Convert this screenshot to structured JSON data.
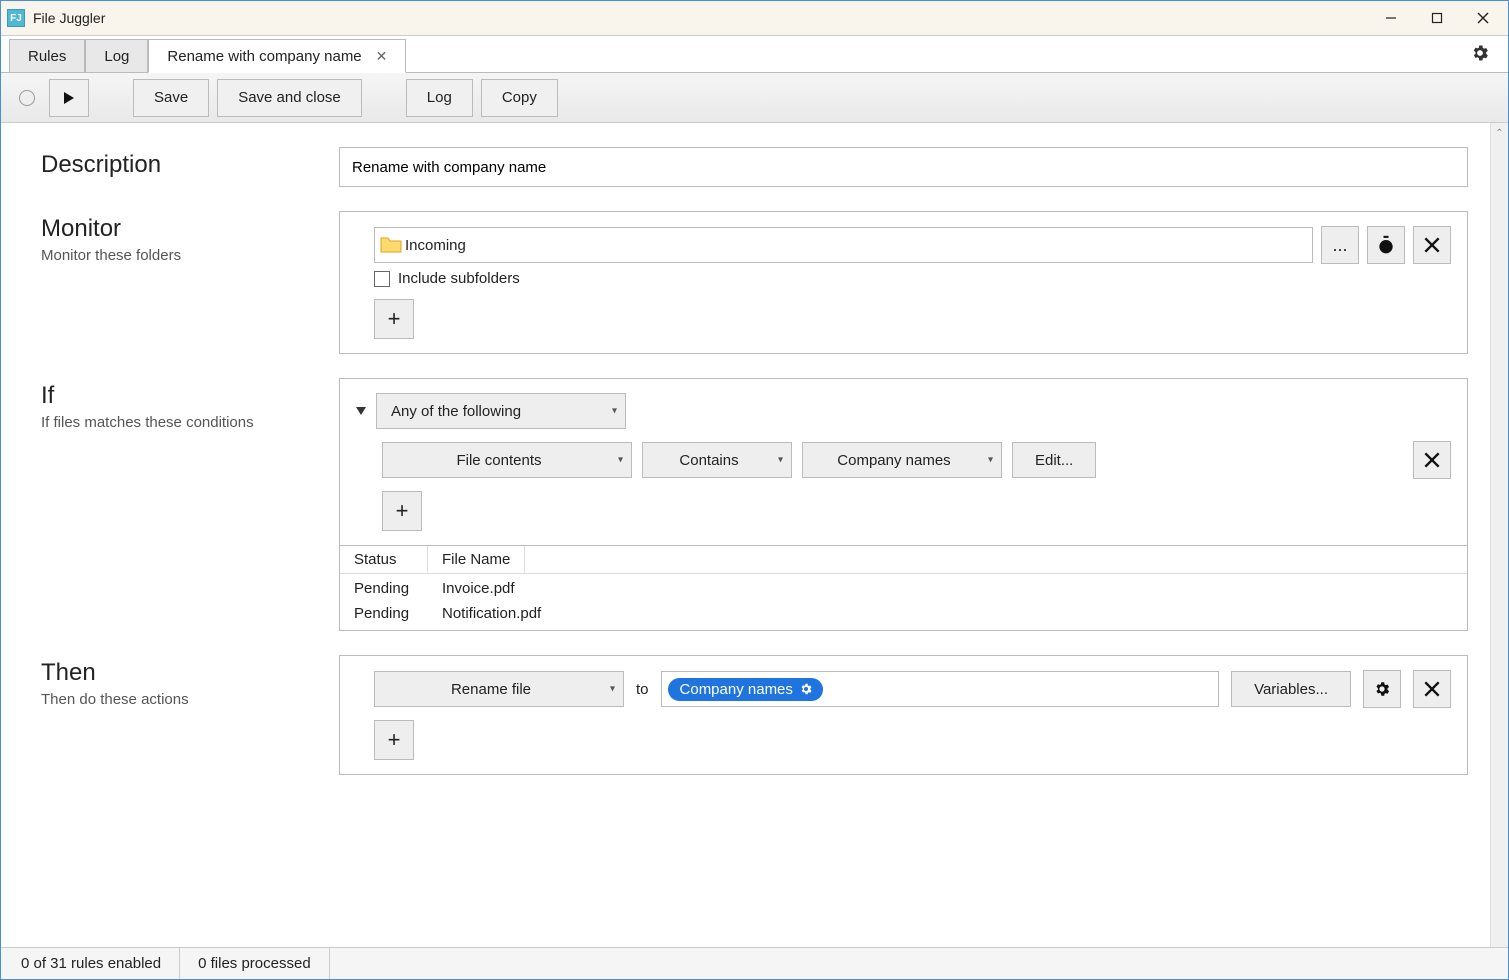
{
  "app": {
    "title": "File Juggler"
  },
  "tabs": {
    "rules": "Rules",
    "log": "Log",
    "current": "Rename with company name"
  },
  "toolbar": {
    "save": "Save",
    "save_close": "Save and close",
    "log": "Log",
    "copy": "Copy"
  },
  "description": {
    "label": "Description",
    "value": "Rename with company name"
  },
  "monitor": {
    "label": "Monitor",
    "sub": "Monitor these folders",
    "folder": "Incoming",
    "browse": "...",
    "include_subfolders": "Include subfolders"
  },
  "if": {
    "label": "If",
    "sub": "If files matches these conditions",
    "any": "Any of the following",
    "field": "File contents",
    "op": "Contains",
    "value": "Company names",
    "edit": "Edit..."
  },
  "table": {
    "col_status": "Status",
    "col_filename": "File Name",
    "rows": [
      {
        "status": "Pending",
        "name": "Invoice.pdf"
      },
      {
        "status": "Pending",
        "name": "Notification.pdf"
      }
    ]
  },
  "then": {
    "label": "Then",
    "sub": "Then do these actions",
    "action": "Rename file",
    "to": "to",
    "pill": "Company names",
    "variables": "Variables..."
  },
  "status": {
    "rules": "0 of 31 rules enabled",
    "files": "0 files processed"
  }
}
